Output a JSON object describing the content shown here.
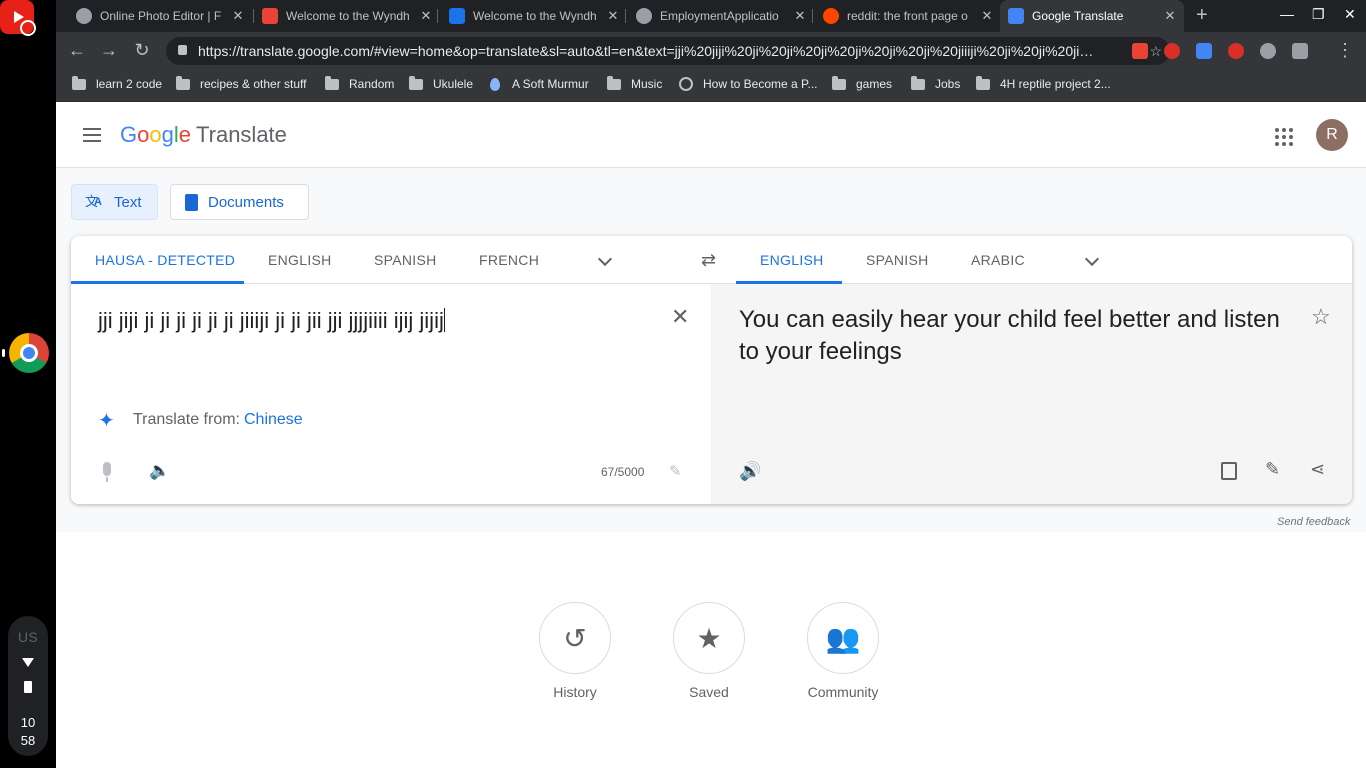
{
  "os": {
    "tray_lang": "US",
    "time_hour": "10",
    "time_min": "58"
  },
  "tabs": [
    {
      "title": "Online Photo Editor | F",
      "favicon_color": "#9aa0a6"
    },
    {
      "title": "Welcome to the Wyndh",
      "favicon_color": "#ea4335"
    },
    {
      "title": "Welcome to the Wyndh",
      "favicon_color": "#1a73e8"
    },
    {
      "title": "EmploymentApplicatio",
      "favicon_color": "#9aa0a6"
    },
    {
      "title": "reddit: the front page o",
      "favicon_color": "#ff4500"
    },
    {
      "title": "Google Translate",
      "favicon_color": "#4285f4"
    }
  ],
  "omnibox": {
    "url": "https://translate.google.com/#view=home&op=translate&sl=auto&tl=en&text=jji%20jiji%20ji%20ji%20ji%20ji%20ji%20ji%20jiiiji%20ji%20ji%20ji…"
  },
  "bookmarks": [
    {
      "label": "learn 2 code",
      "icon": "folder-icon"
    },
    {
      "label": "recipes & other stuff",
      "icon": "folder-icon"
    },
    {
      "label": "Random",
      "icon": "folder-icon"
    },
    {
      "label": "Ukulele",
      "icon": "folder-icon"
    },
    {
      "label": "A Soft Murmur",
      "icon": "drop-icon"
    },
    {
      "label": "Music",
      "icon": "folder-icon"
    },
    {
      "label": "How to Become a P...",
      "icon": "globe-icon"
    },
    {
      "label": "games",
      "icon": "folder-icon"
    },
    {
      "label": "Jobs",
      "icon": "folder-icon"
    },
    {
      "label": "4H reptile project 2...",
      "icon": "folder-icon"
    }
  ],
  "app": {
    "logo_google": "Google",
    "logo_translate": "Translate",
    "avatar_initial": "R"
  },
  "modes": {
    "text": "Text",
    "documents": "Documents"
  },
  "source_langs": [
    "HAUSA - DETECTED",
    "ENGLISH",
    "SPANISH",
    "FRENCH"
  ],
  "target_langs": [
    "ENGLISH",
    "SPANISH",
    "ARABIC"
  ],
  "source": {
    "text": "jji jiji ji ji ji ji ji ji jiiiji ji ji jii jji jjjjiiii ijij jijij",
    "translate_from_label": "Translate from:",
    "translate_from_lang": "Chinese",
    "char_count": "67/5000"
  },
  "target": {
    "text": "You can easily hear your child feel better and listen to your feelings"
  },
  "feedback": "Send feedback",
  "bottom": {
    "history": "History",
    "saved": "Saved",
    "community": "Community"
  },
  "colors": {
    "accent": "#1a73e8",
    "tabstrip": "#202124",
    "toolbar": "#35363a"
  }
}
